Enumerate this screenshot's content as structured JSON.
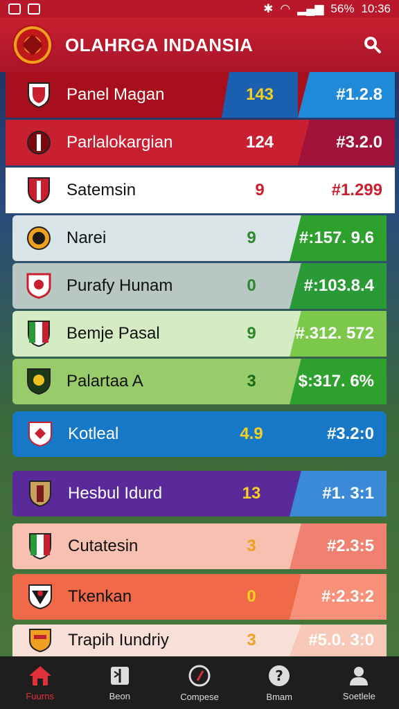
{
  "status": {
    "battery": "56%",
    "time": "10:36"
  },
  "header": {
    "title": "OLAHRGA INDANSIA"
  },
  "rows": [
    {
      "name": "Panel Magan",
      "score": "143",
      "rank": "#1.2.8"
    },
    {
      "name": "Parlalokargian",
      "score": "124",
      "rank": "#3.2.0"
    },
    {
      "name": "Satemsin",
      "score": "9",
      "rank": "#1.299"
    },
    {
      "name": "Narei",
      "score": "9",
      "rank": "#:157. 9.6"
    },
    {
      "name": "Purafy Hunam",
      "score": "0",
      "rank": "#:103.8.4"
    },
    {
      "name": "Bemje Pasal",
      "score": "9",
      "rank": "#.312. 572"
    },
    {
      "name": "Palartaa A",
      "score": "3",
      "rank": "$:317. 6%"
    },
    {
      "name": "Kotleal",
      "score": "4.9",
      "rank": "#3.2:0"
    },
    {
      "name": "Hesbul Idurd",
      "score": "13",
      "rank": "#1. 3:1"
    },
    {
      "name": "Cutatesin",
      "score": "3",
      "rank": "#2.3:5"
    },
    {
      "name": "Tkenkan",
      "score": "0",
      "rank": "#:2.3:2"
    },
    {
      "name": "Trapih Iundriy",
      "score": "3",
      "rank": "#5.0. 3:0"
    }
  ],
  "nav": [
    {
      "label": "Fuurns",
      "icon": "home-icon"
    },
    {
      "label": "Beon",
      "icon": "book-icon"
    },
    {
      "label": "Compese",
      "icon": "compass-icon"
    },
    {
      "label": "Bmam",
      "icon": "question-icon"
    },
    {
      "label": "Soetlele",
      "icon": "profile-icon"
    }
  ]
}
